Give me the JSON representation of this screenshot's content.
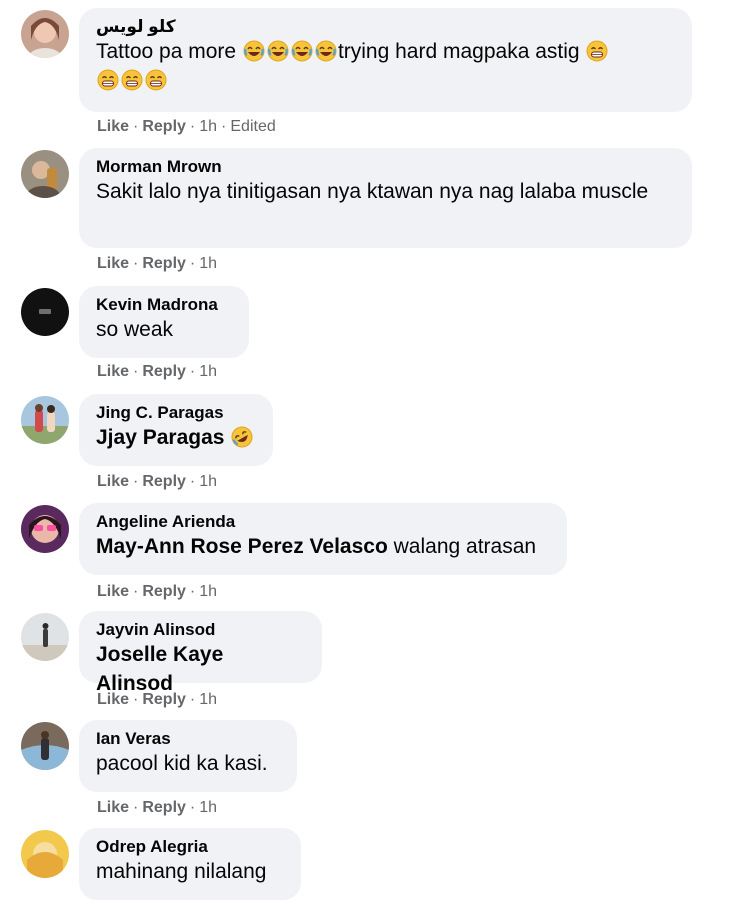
{
  "comments": [
    {
      "author": "كلو لويس",
      "text": "Tattoo pa more",
      "emoji_group1": [
        "joy",
        "joy",
        "joy",
        "joy"
      ],
      "text2": "trying hard magpaka astig",
      "emoji_group2": [
        "grin",
        "grin",
        "grin",
        "grin"
      ],
      "like": "Like",
      "reply": "Reply",
      "time": "1h",
      "edited": "Edited"
    },
    {
      "author": "Morman Mrown",
      "text": "Sakit lalo nya tinitigasan nya ktawan nya nag lalaba muscle",
      "like": "Like",
      "reply": "Reply",
      "time": "1h"
    },
    {
      "author": "Kevin Madrona",
      "text": "so weak",
      "like": "Like",
      "reply": "Reply",
      "time": "1h"
    },
    {
      "author": "Jing C. Paragas",
      "mention": "Jjay Paragas",
      "emoji": "rofl",
      "like": "Like",
      "reply": "Reply",
      "time": "1h"
    },
    {
      "author": "Angeline Arienda",
      "mention": "May-Ann Rose Perez Velasco",
      "text": " walang atrasan",
      "like": "Like",
      "reply": "Reply",
      "time": "1h"
    },
    {
      "author": "Jayvin Alinsod",
      "mention": "Joselle Kaye Alinsod",
      "like": "Like",
      "reply": "Reply",
      "time": "1h"
    },
    {
      "author": "Ian Veras",
      "text": "pacool kid ka kasi.",
      "like": "Like",
      "reply": "Reply",
      "time": "1h"
    },
    {
      "author": "Odrep Alegria",
      "text": "mahinang nilalang"
    }
  ],
  "separator": "·",
  "colors": {
    "bubble": "#f0f2f5",
    "meta": "#65676b",
    "text": "#050505"
  }
}
